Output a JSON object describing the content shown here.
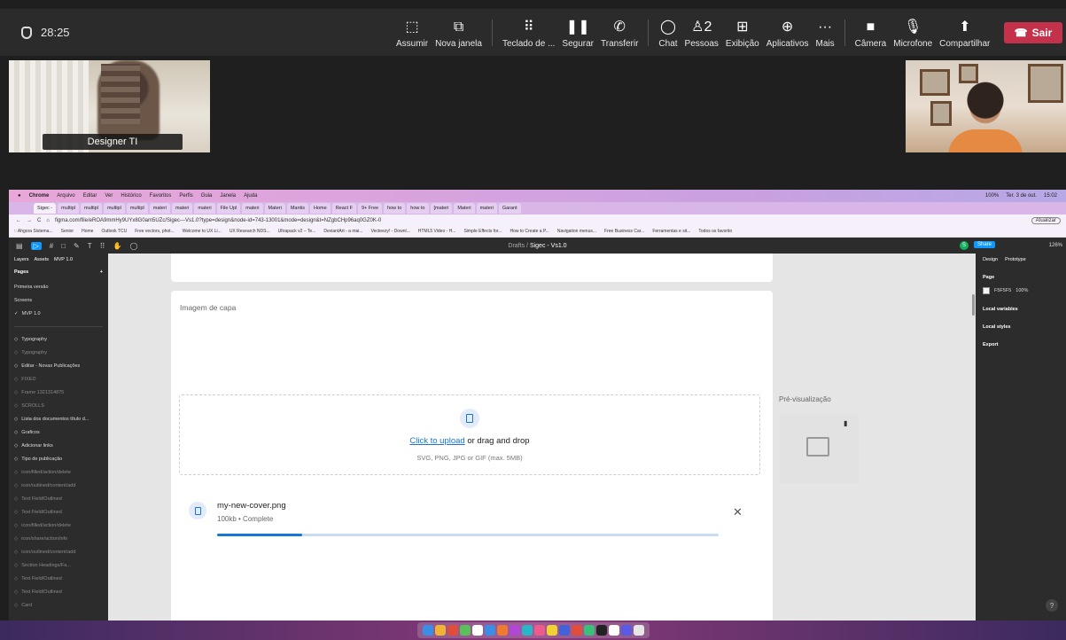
{
  "meeting": {
    "elapsed": "28:25",
    "toolbar": [
      {
        "label": "Assumir",
        "icon": "take-control-icon",
        "glyph": "⬚"
      },
      {
        "label": "Nova janela",
        "icon": "pop-out-icon",
        "glyph": "⧉"
      },
      {
        "label": "Teclado de ...",
        "icon": "dialpad-icon",
        "glyph": "⠿"
      },
      {
        "label": "Segurar",
        "icon": "hold-icon",
        "glyph": "❚❚"
      },
      {
        "label": "Transferir",
        "icon": "transfer-icon",
        "glyph": "✆"
      },
      {
        "label": "Chat",
        "icon": "chat-icon",
        "glyph": "◯"
      },
      {
        "label": "Pessoas",
        "icon": "people-icon",
        "glyph": "♙2"
      },
      {
        "label": "Exibição",
        "icon": "view-icon",
        "glyph": "⊞"
      },
      {
        "label": "Aplicativos",
        "icon": "apps-icon",
        "glyph": "⊕"
      },
      {
        "label": "Mais",
        "icon": "more-icon",
        "glyph": "···"
      },
      {
        "label": "Câmera",
        "icon": "camera-icon",
        "glyph": "■"
      },
      {
        "label": "Microfone",
        "icon": "microphone-icon",
        "glyph": "🎙"
      },
      {
        "label": "Compartilhar",
        "icon": "share-screen-icon",
        "glyph": "⬆"
      }
    ],
    "leave_label": "Sair",
    "leave_color": "#c4314b",
    "participant_name": "Designer TI"
  },
  "mac": {
    "menu": [
      "Chrome",
      "Arquivo",
      "Editar",
      "Ver",
      "Histórico",
      "Favoritos",
      "Perfis",
      "Guia",
      "Janela",
      "Ajuda"
    ],
    "status": [
      "100%",
      "Ter. 3 de out.",
      "15:02"
    ]
  },
  "browser": {
    "tabs": [
      "Sigec -",
      "multipl",
      "multipl",
      "multipl",
      "multipl",
      "materi",
      "materi",
      "materi",
      "File Upl",
      "materi",
      "Materi",
      "Mantis",
      "Home",
      "React F",
      "9+ Free",
      "how to",
      "how to",
      "[materi",
      "Materi",
      "materi",
      "Garant"
    ],
    "url": "figma.com/file/eROA9mmHy9UYx8G0am5UZc/Sigec---Vs1.0?type=design&node-id=743-13001&mode=design&t=NZgbCHp96aq0GZ0K-0",
    "update_label": "Atualizar",
    "bookmarks": [
      ":: Ahgora Sistema...",
      "Senior",
      "Home",
      "Outlook TCU",
      "Free vectors, phot...",
      "Welcome to UX Li...",
      "UX Research NDS...",
      "Ultrapack v2 – Te...",
      "DeviantArt - a mai...",
      "Vecteezy! - Downl...",
      "HTML5 Video - H...",
      "Simple Effects for...",
      "How to Create a P...",
      "Navigation menus...",
      "Free Business Car...",
      "Ferramentas e sit...",
      "Todos os favorito"
    ]
  },
  "figma": {
    "breadcrumb": "Drafts",
    "file_name": "Sigec - Vs1.0",
    "share_label": "Share",
    "zoom": "126%",
    "avatar_initial": "S",
    "left_tabs": [
      "Layers",
      "Assets",
      "MVP 1.0"
    ],
    "pages_title": "Pages",
    "pages": [
      "Primeira versão",
      "Screens",
      "MVP 1.0"
    ],
    "layers": [
      {
        "label": "Typography",
        "dim": false
      },
      {
        "label": "Typography",
        "dim": true
      },
      {
        "label": "Editar - Novas Publicações",
        "dim": false
      },
      {
        "label": "FIXED",
        "dim": true
      },
      {
        "label": "Frame 1321314875",
        "dim": true
      },
      {
        "label": "SCROLLS",
        "dim": true
      },
      {
        "label": "Lista dos documentos título d...",
        "dim": false
      },
      {
        "label": "Graficos",
        "dim": false
      },
      {
        "label": "Adicionar links",
        "dim": false
      },
      {
        "label": "Tipo de publicação",
        "dim": false
      },
      {
        "label": "icon/filled/action/delete",
        "dim": true
      },
      {
        "label": "icon/outlined/content/add",
        "dim": true
      },
      {
        "label": "Text Field/Outlined",
        "dim": true
      },
      {
        "label": "Text Field/Outlined",
        "dim": true
      },
      {
        "label": "icon/filled/action/delete",
        "dim": true
      },
      {
        "label": "icon/share/action/info",
        "dim": true
      },
      {
        "label": "icon/outlined/content/add",
        "dim": true
      },
      {
        "label": "Section Headings/Fa...",
        "dim": true
      },
      {
        "label": "Text Field/Outlined",
        "dim": true
      },
      {
        "label": "Text Field/Outlined",
        "dim": true
      },
      {
        "label": "Card",
        "dim": true
      }
    ],
    "right_tabs": [
      "Design",
      "Prototype"
    ],
    "page_section": "Page",
    "page_fill": "F5F5F5",
    "page_opacity": "100%",
    "local_variables": "Local variables",
    "local_styles": "Local styles",
    "export": "Export"
  },
  "upload": {
    "section_label": "Imagem de capa",
    "link_text": "Click to upload",
    "drop_text": " or drag and drop",
    "hint": "SVG, PNG, JPG or GIF (max. 5MB)",
    "file_name": "my-new-cover.png",
    "file_size": "100kb",
    "file_status": "Complete",
    "progress": 0.17,
    "preview_label": "Pré-visualização",
    "accent": "#1976d2"
  }
}
